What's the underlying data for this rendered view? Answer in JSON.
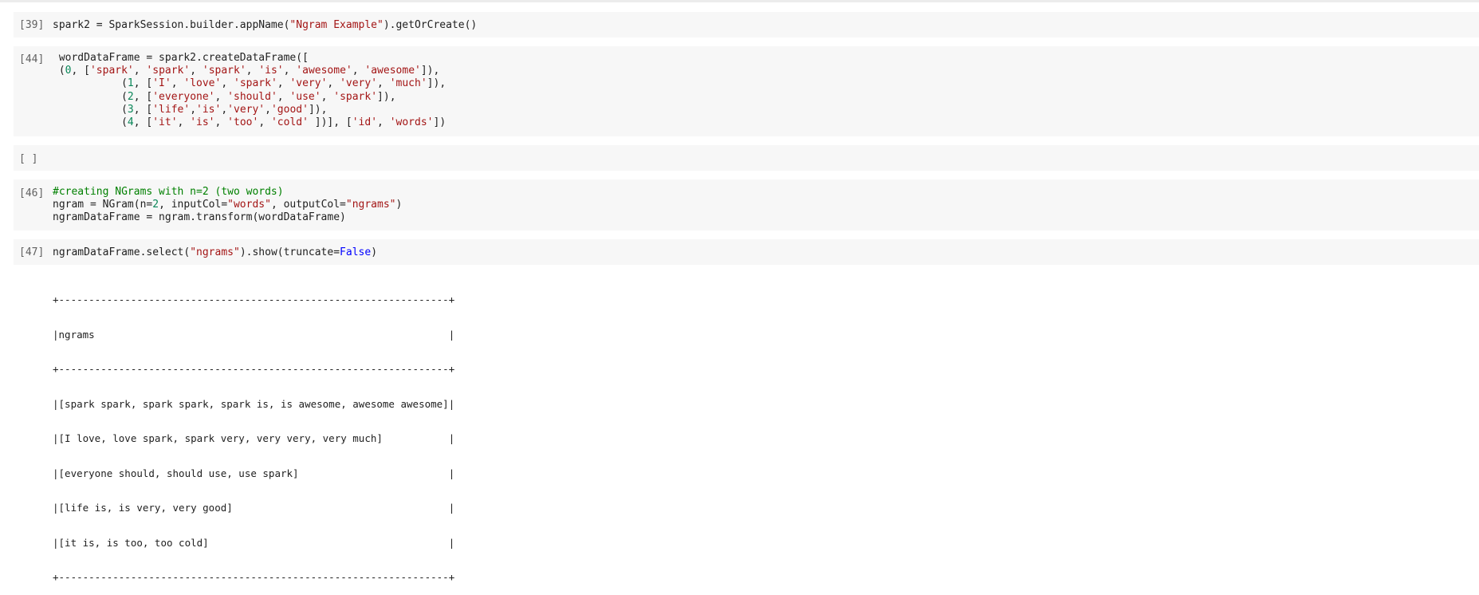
{
  "cells": [
    {
      "prompt": "[39]",
      "lines": [
        "spark2 = SparkSession.builder.appName(\"Ngram Example\").getOrCreate()"
      ]
    },
    {
      "prompt": "[44]",
      "lines": [
        " wordDataFrame = spark2.createDataFrame([",
        " (0, ['spark', 'spark', 'spark', 'is', 'awesome', 'awesome']),",
        "           (1, ['I', 'love', 'spark', 'very', 'very', 'much']),",
        "           (2, ['everyone', 'should', 'use', 'spark']),",
        "           (3, ['life','is','very','good']),",
        "           (4, ['it', 'is', 'too', 'cold' ])], ['id', 'words'])"
      ]
    },
    {
      "prompt": "[ ]",
      "lines": []
    },
    {
      "prompt": "[46]",
      "lines": [
        "#creating NGrams with n=2 (two words)",
        "ngram = NGram(n=2, inputCol=\"words\", outputCol=\"ngrams\")",
        "ngramDataFrame = ngram.transform(wordDataFrame)"
      ]
    },
    {
      "prompt": "[47]",
      "lines": [
        "ngramDataFrame.select(\"ngrams\").show(truncate=False)"
      ]
    }
  ],
  "output_lines": [
    "+-----------------------------------------------------------------+",
    "|ngrams                                                           |",
    "+-----------------------------------------------------------------+",
    "|[spark spark, spark spark, spark is, is awesome, awesome awesome]|",
    "|[I love, love spark, spark very, very very, very much]           |",
    "|[everyone should, should use, use spark]                         |",
    "|[life is, is very, very good]                                    |",
    "|[it is, is too, too cold]                                        |",
    "+-----------------------------------------------------------------+"
  ]
}
